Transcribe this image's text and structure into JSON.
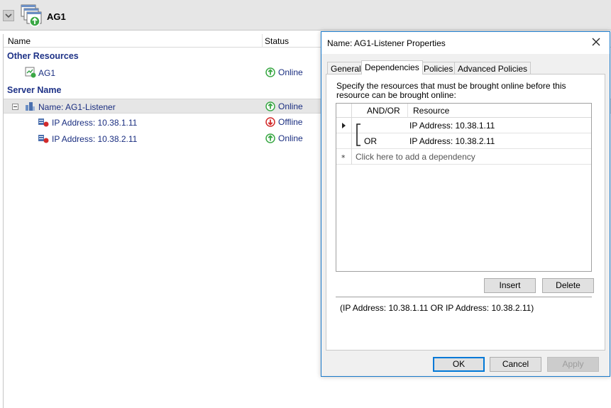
{
  "header": {
    "title": "AG1"
  },
  "columns": {
    "name": "Name",
    "status": "Status"
  },
  "groups": {
    "other_resources": "Other Resources",
    "server_name": "Server Name"
  },
  "resources": [
    {
      "name": "AG1",
      "status": "Online"
    },
    {
      "name": "Name: AG1-Listener",
      "status": "Online"
    },
    {
      "name": "IP Address: 10.38.1.11",
      "status": "Offline"
    },
    {
      "name": "IP Address: 10.38.2.11",
      "status": "Online"
    }
  ],
  "dialog": {
    "title": "Name: AG1-Listener Properties",
    "tabs": [
      "General",
      "Dependencies",
      "Policies",
      "Advanced Policies"
    ],
    "active_tab": "Dependencies",
    "instructions": "Specify the resources that must be brought online before this resource can be brought online:",
    "grid": {
      "col_andor": "AND/OR",
      "col_resource": "Resource",
      "rows": [
        {
          "andor": "",
          "resource": "IP Address: 10.38.1.11"
        },
        {
          "andor": "OR",
          "resource": "IP Address: 10.38.2.11"
        }
      ],
      "add_row": "Click here to add a dependency"
    },
    "insert_label": "Insert",
    "delete_label": "Delete",
    "expression": "(IP Address: 10.38.1.11 OR IP Address: 10.38.2.11)",
    "ok_label": "OK",
    "cancel_label": "Cancel",
    "apply_label": "Apply"
  },
  "colors": {
    "accent": "#0078d7",
    "group_text": "#1e3287",
    "online": "#3aa845",
    "offline": "#d22b2b"
  }
}
